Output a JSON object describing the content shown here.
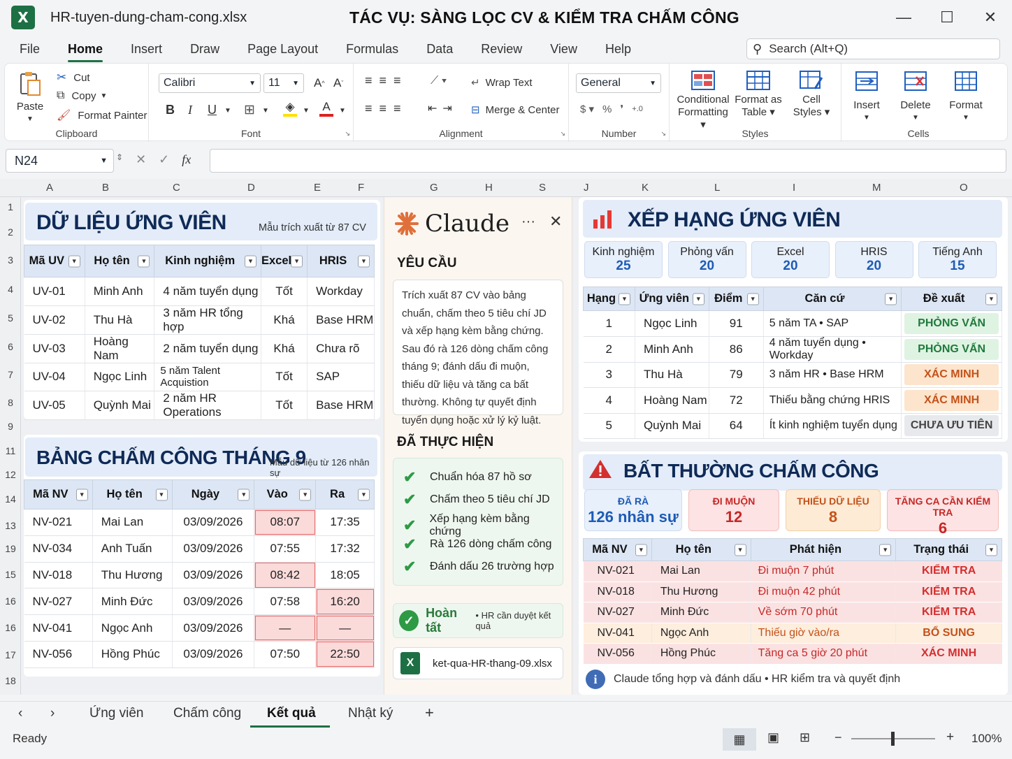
{
  "window": {
    "app_icon": "X",
    "filename": "HR-tuyen-dung-cham-cong.xlsx",
    "title": "TÁC VỤ: SÀNG LỌC CV & KIỂM TRA CHẤM CÔNG"
  },
  "menu": [
    "File",
    "Home",
    "Insert",
    "Draw",
    "Page Layout",
    "Formulas",
    "Data",
    "Review",
    "View",
    "Help"
  ],
  "search": {
    "placeholder": "Search (Alt+Q)"
  },
  "ribbon": {
    "clipboard": {
      "label": "Clipboard",
      "paste": "Paste",
      "cut": "Cut",
      "copy": "Copy",
      "format_painter": "Format Painter"
    },
    "font": {
      "label": "Font",
      "name": "Calibri",
      "size": "11"
    },
    "alignment": {
      "label": "Alignment",
      "wrap": "Wrap Text",
      "merge": "Merge & Center"
    },
    "number": {
      "label": "Number",
      "format": "General"
    },
    "styles": {
      "label": "Styles",
      "cond": "Conditional",
      "cond2": "Formatting",
      "table": "Format as",
      "table2": "Table",
      "cell": "Cell",
      "cell2": "Styles"
    },
    "cells": {
      "label": "Cells",
      "insert": "Insert",
      "delete": "Delete",
      "format": "Format"
    }
  },
  "formula": {
    "namebox": "N24",
    "content": ""
  },
  "columns": [
    "A",
    "B",
    "C",
    "D",
    "E",
    "F",
    "G",
    "H",
    "S",
    "J",
    "K",
    "L",
    "I",
    "M",
    "O"
  ],
  "rows": [
    "1",
    "2",
    "3",
    "4",
    "5",
    "6",
    "7",
    "8",
    "9",
    "11",
    "12",
    "14",
    "13",
    "19",
    "15",
    "16",
    "16",
    "17",
    "18"
  ],
  "candidates": {
    "title": "DỮ LIỆU ỨNG VIÊN",
    "note": "Mẫu trích xuất từ 87 CV",
    "headers": [
      "Mã UV",
      "Họ tên",
      "Kinh nghiệm",
      "Excel",
      "HRIS"
    ],
    "rows": [
      [
        "UV-01",
        "Minh Anh",
        "4 năm tuyển dụng",
        "Tốt",
        "Workday"
      ],
      [
        "UV-02",
        "Thu Hà",
        "3 năm HR tổng hợp",
        "Khá",
        "Base HRM"
      ],
      [
        "UV-03",
        "Hoàng Nam",
        "2 năm tuyển dụng",
        "Khá",
        "Chưa rõ"
      ],
      [
        "UV-04",
        "Ngọc Linh",
        "5 năm Talent Acquistion",
        "Tốt",
        "SAP"
      ],
      [
        "UV-05",
        "Quỳnh Mai",
        "2 năm HR Operations",
        "Tốt",
        "Base HRM"
      ]
    ]
  },
  "attendance": {
    "title": "BẢNG CHẤM CÔNG THÁNG 9",
    "note": "Mẫu dữ liệu từ 126 nhân sự",
    "headers": [
      "Mã NV",
      "Họ tên",
      "Ngày",
      "Vào",
      "Ra"
    ],
    "rows": [
      {
        "id": "NV-021",
        "name": "Mai Lan",
        "date": "03/09/2026",
        "in": "08:07",
        "out": "17:35",
        "in_flag": true,
        "out_flag": false
      },
      {
        "id": "NV-034",
        "name": "Anh Tuấn",
        "date": "03/09/2026",
        "in": "07:55",
        "out": "17:32",
        "in_flag": false,
        "out_flag": false
      },
      {
        "id": "NV-018",
        "name": "Thu Hương",
        "date": "03/09/2026",
        "in": "08:42",
        "out": "18:05",
        "in_flag": true,
        "out_flag": false
      },
      {
        "id": "NV-027",
        "name": "Minh Đức",
        "date": "03/09/2026",
        "in": "07:58",
        "out": "16:20",
        "in_flag": false,
        "out_flag": true
      },
      {
        "id": "NV-041",
        "name": "Ngọc Anh",
        "date": "03/09/2026",
        "in": "—",
        "out": "—",
        "in_flag": true,
        "out_flag": true
      },
      {
        "id": "NV-056",
        "name": "Hồng Phúc",
        "date": "03/09/2026",
        "in": "07:50",
        "out": "22:50",
        "in_flag": false,
        "out_flag": true
      }
    ]
  },
  "claude": {
    "name": "Claude",
    "more": "···",
    "close": "✕",
    "request_title": "YÊU CẦU",
    "request": "Trích xuất 87 CV vào bảng chuẩn, chấm theo 5 tiêu chí JD và xếp hạng kèm bằng chứng. Sau đó rà 126 dòng chấm công tháng 9; đánh dấu đi muộn, thiếu dữ liệu và tăng ca bất thường. Không tự quyết định tuyển dụng hoặc xử lý kỷ luật.",
    "done_title": "ĐÃ THỰC HIỆN",
    "done": [
      "Chuẩn hóa 87 hồ sơ",
      "Chấm theo 5 tiêu chí JD",
      "Xếp hạng kèm bằng chứng",
      "Rà 126 dòng chấm công",
      "Đánh dấu 26 trường hợp"
    ],
    "finish": "Hoàn tất",
    "finish_note": "• HR cần duyệt kết quả",
    "file": "ket-qua-HR-thang-09.xlsx"
  },
  "ranking": {
    "title": "XẾP HẠNG ỨNG VIÊN",
    "criteria": [
      {
        "label": "Kinh nghiệm",
        "value": "25"
      },
      {
        "label": "Phỏng vấn",
        "value": "20"
      },
      {
        "label": "Excel",
        "value": "20"
      },
      {
        "label": "HRIS",
        "value": "20"
      },
      {
        "label": "Tiếng Anh",
        "value": "15"
      }
    ],
    "headers": [
      "Hạng",
      "Ứng viên",
      "Điểm",
      "Căn cứ",
      "Đề xuất"
    ],
    "rows": [
      {
        "rank": "1",
        "name": "Ngọc Linh",
        "score": "91",
        "basis": "5 năm TA • SAP",
        "rec": "PHỎNG VẤN",
        "tone": "green"
      },
      {
        "rank": "2",
        "name": "Minh Anh",
        "score": "86",
        "basis": "4 năm tuyển dụng • Workday",
        "rec": "PHỎNG VẤN",
        "tone": "green"
      },
      {
        "rank": "3",
        "name": "Thu Hà",
        "score": "79",
        "basis": "3 năm HR • Base HRM",
        "rec": "XÁC MINH",
        "tone": "orange"
      },
      {
        "rank": "4",
        "name": "Hoàng Nam",
        "score": "72",
        "basis": "Thiếu bằng chứng HRIS",
        "rec": "XÁC MINH",
        "tone": "orange"
      },
      {
        "rank": "5",
        "name": "Quỳnh Mai",
        "score": "64",
        "basis": "Ít kinh nghiệm tuyển dụng",
        "rec": "CHƯA ƯU TIÊN",
        "tone": "gray"
      }
    ]
  },
  "anomalies": {
    "title": "BẤT THƯỜNG CHẤM CÔNG",
    "cards": [
      {
        "label": "ĐÃ RÀ",
        "value": "126 nhân sự"
      },
      {
        "label": "ĐI MUỘN",
        "value": "12"
      },
      {
        "label": "THIẾU DỮ LIỆU",
        "value": "8"
      },
      {
        "label": "TĂNG CA CẦN KIỂM TRA",
        "value": "6"
      }
    ],
    "headers": [
      "Mã NV",
      "Họ tên",
      "Phát hiện",
      "Trạng thái"
    ],
    "rows": [
      {
        "id": "NV-021",
        "name": "Mai Lan",
        "finding": "Đi muộn 7 phút",
        "status": "KIỂM TRA",
        "tone": "red"
      },
      {
        "id": "NV-018",
        "name": "Thu Hương",
        "finding": "Đi muộn 42 phút",
        "status": "KIỂM TRA",
        "tone": "red"
      },
      {
        "id": "NV-027",
        "name": "Minh Đức",
        "finding": "Về sớm 70 phút",
        "status": "KIỂM TRA",
        "tone": "red"
      },
      {
        "id": "NV-041",
        "name": "Ngọc Anh",
        "finding": "Thiếu giờ vào/ra",
        "status": "BỔ SUNG",
        "tone": "orange"
      },
      {
        "id": "NV-056",
        "name": "Hồng Phúc",
        "finding": "Tăng ca 5 giờ 20 phút",
        "status": "XÁC MINH",
        "tone": "red"
      }
    ],
    "footer": "Claude tổng hợp và đánh dấu  •  HR kiểm tra và quyết định"
  },
  "sheets": [
    "Ứng viên",
    "Chấm công",
    "Kết quả",
    "Nhật ký"
  ],
  "status": {
    "ready": "Ready",
    "zoom": "100%"
  },
  "colors": {
    "excel_green": "#1d7044",
    "navy": "#0f2a57",
    "claude_orange": "#e0703a",
    "flag_red": "#d32f2f"
  }
}
